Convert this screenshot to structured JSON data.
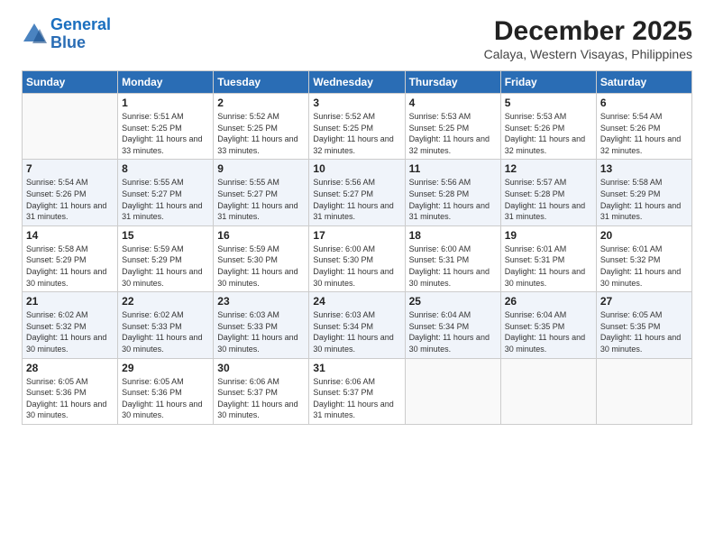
{
  "header": {
    "logo_line1": "General",
    "logo_line2": "Blue",
    "main_title": "December 2025",
    "subtitle": "Calaya, Western Visayas, Philippines"
  },
  "calendar": {
    "days_of_week": [
      "Sunday",
      "Monday",
      "Tuesday",
      "Wednesday",
      "Thursday",
      "Friday",
      "Saturday"
    ],
    "weeks": [
      [
        {
          "num": "",
          "sunrise": "",
          "sunset": "",
          "daylight": ""
        },
        {
          "num": "1",
          "sunrise": "Sunrise: 5:51 AM",
          "sunset": "Sunset: 5:25 PM",
          "daylight": "Daylight: 11 hours and 33 minutes."
        },
        {
          "num": "2",
          "sunrise": "Sunrise: 5:52 AM",
          "sunset": "Sunset: 5:25 PM",
          "daylight": "Daylight: 11 hours and 33 minutes."
        },
        {
          "num": "3",
          "sunrise": "Sunrise: 5:52 AM",
          "sunset": "Sunset: 5:25 PM",
          "daylight": "Daylight: 11 hours and 32 minutes."
        },
        {
          "num": "4",
          "sunrise": "Sunrise: 5:53 AM",
          "sunset": "Sunset: 5:25 PM",
          "daylight": "Daylight: 11 hours and 32 minutes."
        },
        {
          "num": "5",
          "sunrise": "Sunrise: 5:53 AM",
          "sunset": "Sunset: 5:26 PM",
          "daylight": "Daylight: 11 hours and 32 minutes."
        },
        {
          "num": "6",
          "sunrise": "Sunrise: 5:54 AM",
          "sunset": "Sunset: 5:26 PM",
          "daylight": "Daylight: 11 hours and 32 minutes."
        }
      ],
      [
        {
          "num": "7",
          "sunrise": "Sunrise: 5:54 AM",
          "sunset": "Sunset: 5:26 PM",
          "daylight": "Daylight: 11 hours and 31 minutes."
        },
        {
          "num": "8",
          "sunrise": "Sunrise: 5:55 AM",
          "sunset": "Sunset: 5:27 PM",
          "daylight": "Daylight: 11 hours and 31 minutes."
        },
        {
          "num": "9",
          "sunrise": "Sunrise: 5:55 AM",
          "sunset": "Sunset: 5:27 PM",
          "daylight": "Daylight: 11 hours and 31 minutes."
        },
        {
          "num": "10",
          "sunrise": "Sunrise: 5:56 AM",
          "sunset": "Sunset: 5:27 PM",
          "daylight": "Daylight: 11 hours and 31 minutes."
        },
        {
          "num": "11",
          "sunrise": "Sunrise: 5:56 AM",
          "sunset": "Sunset: 5:28 PM",
          "daylight": "Daylight: 11 hours and 31 minutes."
        },
        {
          "num": "12",
          "sunrise": "Sunrise: 5:57 AM",
          "sunset": "Sunset: 5:28 PM",
          "daylight": "Daylight: 11 hours and 31 minutes."
        },
        {
          "num": "13",
          "sunrise": "Sunrise: 5:58 AM",
          "sunset": "Sunset: 5:29 PM",
          "daylight": "Daylight: 11 hours and 31 minutes."
        }
      ],
      [
        {
          "num": "14",
          "sunrise": "Sunrise: 5:58 AM",
          "sunset": "Sunset: 5:29 PM",
          "daylight": "Daylight: 11 hours and 30 minutes."
        },
        {
          "num": "15",
          "sunrise": "Sunrise: 5:59 AM",
          "sunset": "Sunset: 5:29 PM",
          "daylight": "Daylight: 11 hours and 30 minutes."
        },
        {
          "num": "16",
          "sunrise": "Sunrise: 5:59 AM",
          "sunset": "Sunset: 5:30 PM",
          "daylight": "Daylight: 11 hours and 30 minutes."
        },
        {
          "num": "17",
          "sunrise": "Sunrise: 6:00 AM",
          "sunset": "Sunset: 5:30 PM",
          "daylight": "Daylight: 11 hours and 30 minutes."
        },
        {
          "num": "18",
          "sunrise": "Sunrise: 6:00 AM",
          "sunset": "Sunset: 5:31 PM",
          "daylight": "Daylight: 11 hours and 30 minutes."
        },
        {
          "num": "19",
          "sunrise": "Sunrise: 6:01 AM",
          "sunset": "Sunset: 5:31 PM",
          "daylight": "Daylight: 11 hours and 30 minutes."
        },
        {
          "num": "20",
          "sunrise": "Sunrise: 6:01 AM",
          "sunset": "Sunset: 5:32 PM",
          "daylight": "Daylight: 11 hours and 30 minutes."
        }
      ],
      [
        {
          "num": "21",
          "sunrise": "Sunrise: 6:02 AM",
          "sunset": "Sunset: 5:32 PM",
          "daylight": "Daylight: 11 hours and 30 minutes."
        },
        {
          "num": "22",
          "sunrise": "Sunrise: 6:02 AM",
          "sunset": "Sunset: 5:33 PM",
          "daylight": "Daylight: 11 hours and 30 minutes."
        },
        {
          "num": "23",
          "sunrise": "Sunrise: 6:03 AM",
          "sunset": "Sunset: 5:33 PM",
          "daylight": "Daylight: 11 hours and 30 minutes."
        },
        {
          "num": "24",
          "sunrise": "Sunrise: 6:03 AM",
          "sunset": "Sunset: 5:34 PM",
          "daylight": "Daylight: 11 hours and 30 minutes."
        },
        {
          "num": "25",
          "sunrise": "Sunrise: 6:04 AM",
          "sunset": "Sunset: 5:34 PM",
          "daylight": "Daylight: 11 hours and 30 minutes."
        },
        {
          "num": "26",
          "sunrise": "Sunrise: 6:04 AM",
          "sunset": "Sunset: 5:35 PM",
          "daylight": "Daylight: 11 hours and 30 minutes."
        },
        {
          "num": "27",
          "sunrise": "Sunrise: 6:05 AM",
          "sunset": "Sunset: 5:35 PM",
          "daylight": "Daylight: 11 hours and 30 minutes."
        }
      ],
      [
        {
          "num": "28",
          "sunrise": "Sunrise: 6:05 AM",
          "sunset": "Sunset: 5:36 PM",
          "daylight": "Daylight: 11 hours and 30 minutes."
        },
        {
          "num": "29",
          "sunrise": "Sunrise: 6:05 AM",
          "sunset": "Sunset: 5:36 PM",
          "daylight": "Daylight: 11 hours and 30 minutes."
        },
        {
          "num": "30",
          "sunrise": "Sunrise: 6:06 AM",
          "sunset": "Sunset: 5:37 PM",
          "daylight": "Daylight: 11 hours and 30 minutes."
        },
        {
          "num": "31",
          "sunrise": "Sunrise: 6:06 AM",
          "sunset": "Sunset: 5:37 PM",
          "daylight": "Daylight: 11 hours and 31 minutes."
        },
        {
          "num": "",
          "sunrise": "",
          "sunset": "",
          "daylight": ""
        },
        {
          "num": "",
          "sunrise": "",
          "sunset": "",
          "daylight": ""
        },
        {
          "num": "",
          "sunrise": "",
          "sunset": "",
          "daylight": ""
        }
      ]
    ]
  }
}
